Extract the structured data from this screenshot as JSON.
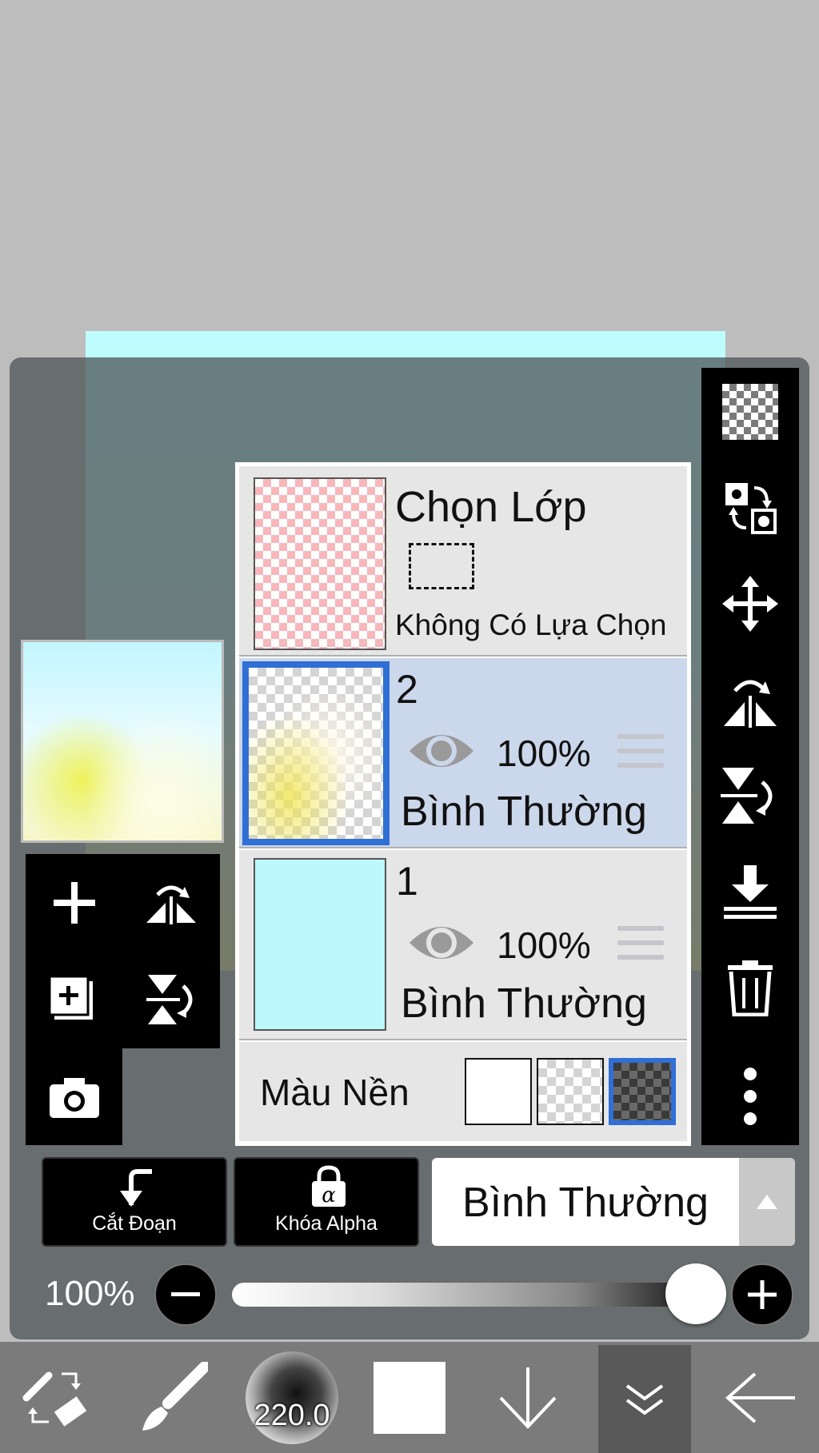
{
  "layer_panel": {
    "selection_layer": {
      "title": "Chọn Lớp",
      "status": "Không Có Lựa Chọn"
    },
    "layers": [
      {
        "number": "2",
        "opacity": "100%",
        "blend_mode": "Bình Thường",
        "selected": true
      },
      {
        "number": "1",
        "opacity": "100%",
        "blend_mode": "Bình Thường",
        "selected": false
      }
    ],
    "background": {
      "label": "Màu Nền",
      "options": [
        "white",
        "transparent",
        "dark-checker"
      ],
      "selected": "dark-checker"
    }
  },
  "actions": {
    "clip_label": "Cắt Đoạn",
    "alpha_lock_label": "Khóa Alpha",
    "blend_mode": "Bình Thường"
  },
  "opacity": {
    "label": "100%",
    "value": 1.0
  },
  "bottom_bar": {
    "brush_size": "220.0",
    "color": "#ffffff"
  },
  "right_toolbar": {
    "icons": [
      "transparency-icon",
      "swap-icon",
      "move-icon",
      "flip-horizontal-icon",
      "flip-vertical-icon",
      "merge-down-icon",
      "trash-icon",
      "more-icon"
    ]
  },
  "left_tools": {
    "icons": [
      "add-layer-icon",
      "flip-horizontal-icon",
      "duplicate-layer-icon",
      "flip-vertical-icon",
      "camera-icon"
    ]
  },
  "colors": {
    "selected_accent": "#2f6fd6",
    "selected_row": "#cbd7ea",
    "toolbar": "#000000"
  }
}
